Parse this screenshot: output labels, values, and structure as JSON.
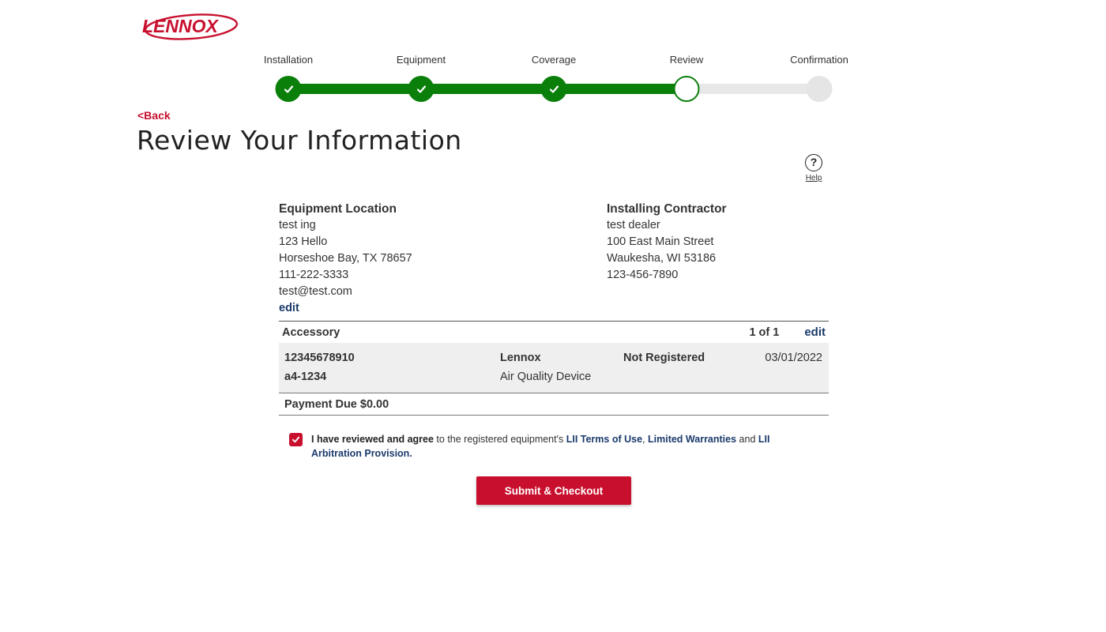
{
  "brand": {
    "logo_text": "LENNOX",
    "accent_color": "#c8102e",
    "success_color": "#0a7f0a",
    "link_color": "#1b3a6b"
  },
  "stepper": {
    "steps": [
      {
        "label": "Installation",
        "state": "complete"
      },
      {
        "label": "Equipment",
        "state": "complete"
      },
      {
        "label": "Coverage",
        "state": "complete"
      },
      {
        "label": "Review",
        "state": "current"
      },
      {
        "label": "Confirmation",
        "state": "upcoming"
      }
    ]
  },
  "nav": {
    "back_label": "<Back"
  },
  "page": {
    "title": "Review Your Information"
  },
  "help": {
    "icon": "question-circle-icon",
    "glyph": "?",
    "label": "Help"
  },
  "equipment_location": {
    "heading": "Equipment Location",
    "name": "test ing",
    "street": "123 Hello",
    "city_state_zip": "Horseshoe Bay, TX 78657",
    "phone": "111-222-3333",
    "email": "test@test.com",
    "edit_label": "edit"
  },
  "installing_contractor": {
    "heading": "Installing Contractor",
    "name": "test dealer",
    "street": "100 East Main Street",
    "city_state_zip": "Waukesha, WI 53186",
    "phone": "123-456-7890"
  },
  "accessory": {
    "heading": "Accessory",
    "count": "1 of 1",
    "edit_label": "edit",
    "row": {
      "serial": "12345678910",
      "model": "a4-1234",
      "brand": "Lennox",
      "type": "Air Quality Device",
      "status": "Not Registered",
      "date": "03/01/2022"
    }
  },
  "payment": {
    "label": "Payment Due $0.00"
  },
  "agreement": {
    "checked": true,
    "bold_lead": "I have reviewed and agree",
    "text_1": " to the registered equipment's ",
    "link_terms": "LII Terms of Use",
    "sep": ", ",
    "link_warranties": "Limited Warranties",
    "and": " and ",
    "link_arbitration": "LII Arbitration Provision."
  },
  "actions": {
    "submit_label": "Submit & Checkout"
  }
}
